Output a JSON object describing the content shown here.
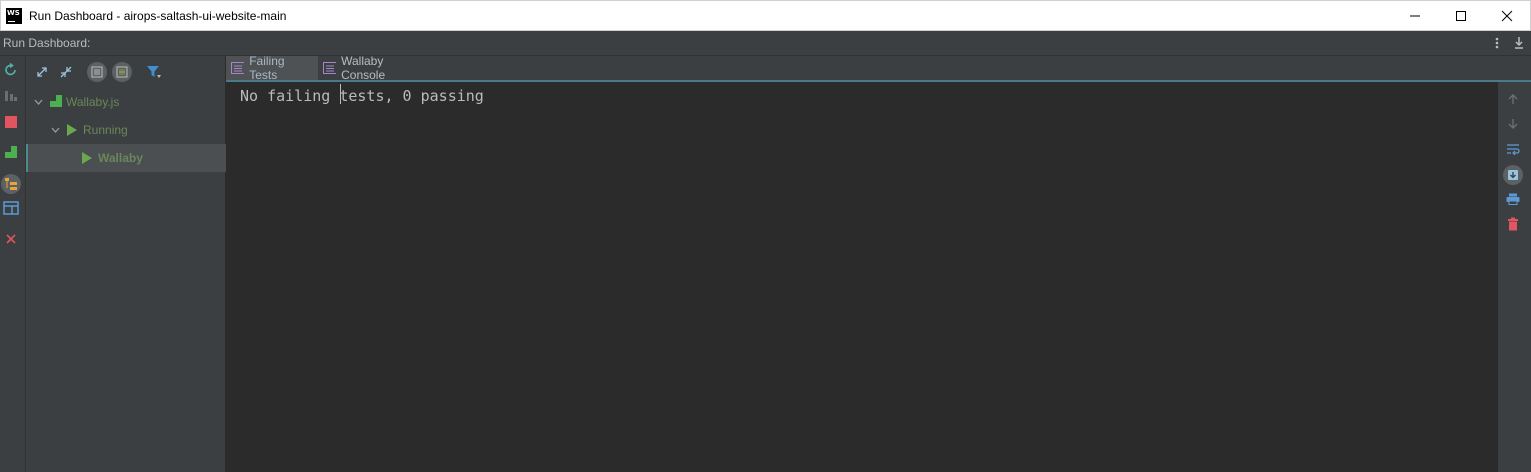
{
  "window": {
    "title": "Run Dashboard - airops-saltash-ui-website-main",
    "logo_text": "WS"
  },
  "tool_window": {
    "title": "Run Dashboard:"
  },
  "tree": {
    "items": [
      {
        "label": "Wallaby.js",
        "icon": "config-icon"
      },
      {
        "label": "Running",
        "icon": "run-icon"
      },
      {
        "label": "Wallaby",
        "icon": "run-icon"
      }
    ]
  },
  "tabs": [
    {
      "label": "Failing Tests",
      "active": true
    },
    {
      "label": "Wallaby Console",
      "active": false
    }
  ],
  "console": {
    "output": "No failing tests, 0 passing"
  },
  "colors": {
    "background": "#2b2b2b",
    "panel": "#3c3f41",
    "tree_text": "#6a8759",
    "stop_red": "#e05555",
    "accent_teal": "#4a7a87"
  }
}
